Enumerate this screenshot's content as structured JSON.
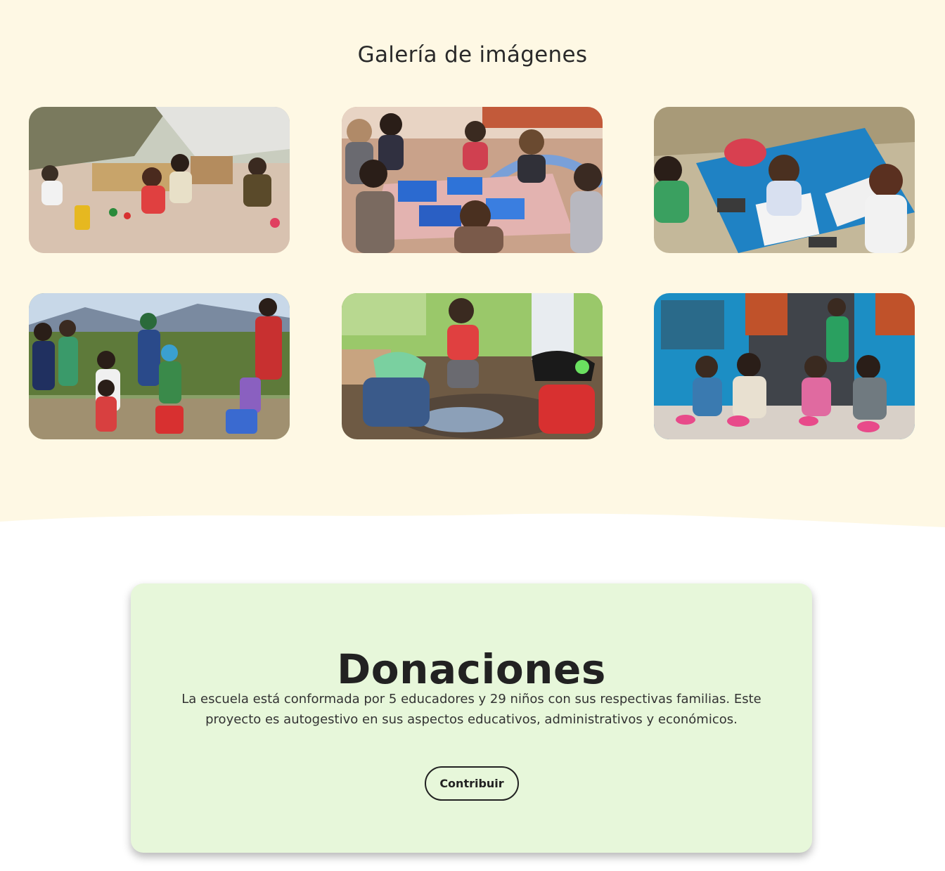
{
  "gallery": {
    "title": "Galería de imágenes",
    "photos": [
      {
        "subject": "children playing in a sandbox outdoors"
      },
      {
        "subject": "children painting blue at a classroom table"
      },
      {
        "subject": "children painting with watercolors on a blue mat"
      },
      {
        "subject": "group of children and an educator outdoors with backpacks"
      },
      {
        "subject": "children playing in mud and water outdoors"
      },
      {
        "subject": "toddlers sitting with pink bowls in front of a blue building"
      }
    ]
  },
  "donations": {
    "title": "Donaciones",
    "text": "La escuela está conformada por 5 educadores y 29 niños con sus respectivas familias. Este proyecto es autogestivo en sus aspectos educativos, administrativos y económicos.",
    "button_label": "Contribuir"
  },
  "colors": {
    "gallery_bg": "#fef8e4",
    "card_bg": "#e7f7da",
    "text": "#222222"
  }
}
